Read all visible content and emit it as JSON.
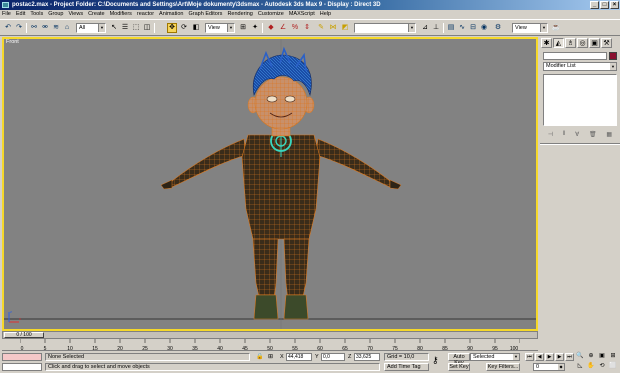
{
  "window": {
    "title": "postac2.max    - Project Folder: C:\\Documents and Settings\\Art\\Moje dokumenty\\3dsmax    - Autodesk 3ds Max 9    - Display : Direct 3D",
    "controls": [
      "_",
      "□",
      "×"
    ]
  },
  "menu": [
    "File",
    "Edit",
    "Tools",
    "Group",
    "Views",
    "Create",
    "Modifiers",
    "reactor",
    "Animation",
    "Graph Editors",
    "Rendering",
    "Customize",
    "MAXScript",
    "Help"
  ],
  "toolbar": {
    "selection_filter": "All",
    "ref_coord": "View",
    "named_selection": "",
    "render_type": "View"
  },
  "viewport": {
    "label": "Front",
    "background": "#828282",
    "active_border": "#f5d82a"
  },
  "command_panel": {
    "modifier_list": "Modifier List",
    "object_color": "#8a1030"
  },
  "timeline": {
    "frame_label": "0 / 100",
    "ruler_ticks": [
      "0",
      "5",
      "10",
      "15",
      "20",
      "25",
      "30",
      "35",
      "40",
      "45",
      "50",
      "55",
      "60",
      "65",
      "70",
      "75",
      "80",
      "85",
      "90",
      "95",
      "100"
    ]
  },
  "status": {
    "selection": "None Selected",
    "prompt": "Click and drag to select and move objects",
    "x_label": "X",
    "y_label": "Y",
    "z_label": "Z",
    "x_value": "44,418",
    "y_value": "0,0",
    "z_value": "33,625",
    "grid": "Grid = 10,0",
    "add_time_tag": "Add Time Tag",
    "auto_key": "Auto Key",
    "set_key": "Set Key",
    "key_mode": "Selected",
    "key_filters": "Key Filters...",
    "current_frame": "0"
  }
}
